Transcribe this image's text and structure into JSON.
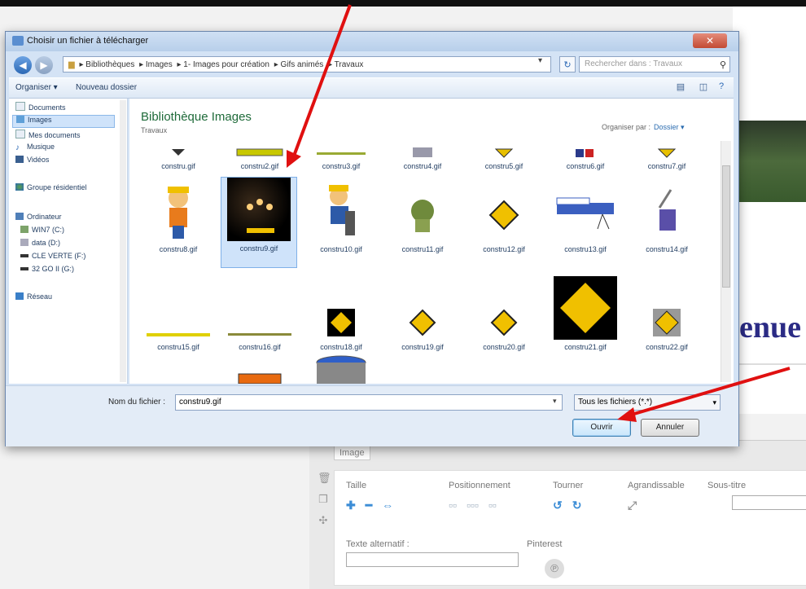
{
  "dialog": {
    "title": "Choisir un fichier à télécharger",
    "close": "✕",
    "breadcrumb": [
      "▸ Bibliothèques",
      "▸ Images",
      "▸ 1- Images pour création",
      "▸ Gifs animés",
      "▸ Travaux"
    ],
    "search_placeholder": "Rechercher dans : Travaux",
    "toolbar": {
      "organize": "Organiser ▾",
      "new_folder": "Nouveau dossier"
    },
    "nav": [
      {
        "label": "Documents",
        "icon": "document-icon"
      },
      {
        "label": "Images",
        "icon": "images-icon",
        "selected": true
      },
      {
        "label": "Mes documents",
        "icon": "document-icon"
      },
      {
        "label": "Musique",
        "icon": "music-icon"
      },
      {
        "label": "Vidéos",
        "icon": "video-icon"
      },
      {
        "label": "Groupe résidentiel",
        "icon": "homegroup-icon"
      },
      {
        "label": "Ordinateur",
        "icon": "computer-icon"
      },
      {
        "label": "WIN7 (C:)",
        "icon": "drive-icon"
      },
      {
        "label": "data (D:)",
        "icon": "drive-icon"
      },
      {
        "label": "CLE VERTE (F:)",
        "icon": "usb-drive-icon"
      },
      {
        "label": "32 GO II (G:)",
        "icon": "usb-drive-icon"
      },
      {
        "label": "Réseau",
        "icon": "network-icon"
      }
    ],
    "library_title": "Bibliothèque Images",
    "library_sub": "Travaux",
    "arrange_label": "Organiser par :",
    "arrange_value": "Dossier ▾",
    "files": [
      "constru.gif",
      "constru2.gif",
      "constru3.gif",
      "constru4.gif",
      "constru5.gif",
      "constru6.gif",
      "constru7.gif",
      "constru8.gif",
      "constru9.gif",
      "constru10.gif",
      "constru11.gif",
      "constru12.gif",
      "constru13.gif",
      "constru14.gif",
      "constru15.gif",
      "constru16.gif",
      "constru18.gif",
      "constru19.gif",
      "constru20.gif",
      "constru21.gif",
      "constru22.gif"
    ],
    "selected_file": "constru9.gif",
    "filename_label": "Nom du fichier :",
    "filename_value": "constru9.gif",
    "filetype_value": "Tous les fichiers (*.*)",
    "open_button": "Ouvrir",
    "cancel_button": "Annuler"
  },
  "background": {
    "headline": "enue",
    "image_tab": "Image",
    "size_label": "Taille",
    "position_label": "Positionnement",
    "rotate_label": "Tourner",
    "enlarge_label": "Agrandissable",
    "subtitle_label": "Sous-titre",
    "alt_label": "Texte alternatif :",
    "pinterest_label": "Pinterest"
  }
}
